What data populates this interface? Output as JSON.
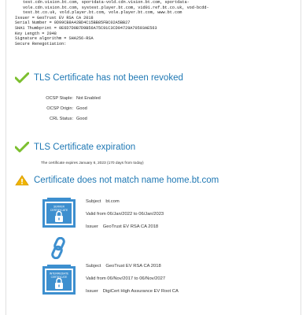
{
  "raw_cert": {
    "lines": [
      "test.cdn.vision.bt.com, sportdata-vold.cdn.vision.bt.com, sportdata-",
      "vole.cdn.vision.bt.com, systest.player.bt.com, vid01.ref.bt.co.uk, vod-bcdd-",
      "test.bt.co.uk, vold.player.bt.com, vole.player.bt.com, www.bt.com",
      "Issuer = GeoTrust EV RSA CA 2018",
      "Serial Number = 0D99CB8A42BD4C15BB85FBC02A5BB27",
      "SHA1 Thumbprint = 0E6D7D0B7D9B56A75C91C3CD94729A70593AE563",
      "Key Length = 2048",
      "Signature algorithm = SHA256-RSA",
      "Secure Renegotiation:"
    ]
  },
  "checks": {
    "revoked": {
      "title": "TLS Certificate has not been revoked",
      "rows": [
        {
          "key": "OCSP Staple:",
          "value": "Not Enabled"
        },
        {
          "key": "OCSP Origin:",
          "value": "Good"
        },
        {
          "key": "CRL Status:",
          "value": "Good"
        }
      ]
    },
    "expiration": {
      "title": "TLS Certificate expiration",
      "note": "The certificate expires January 6, 2023 (170 days from today)"
    },
    "name_mismatch": {
      "title": "Certificate does not match name home.bt.com"
    }
  },
  "chain": {
    "server": {
      "badge_line1": "SERVER",
      "badge_line2": "CERTIFICATE",
      "subject_label": "Subject",
      "subject": "bt.com",
      "valid": "Valid from 06/Jan/2022 to 06/Jan/2023",
      "issuer_label": "Issuer",
      "issuer": "GeoTrust EV RSA CA 2018"
    },
    "intermediate": {
      "badge_line1": "INTERMEDIATE",
      "badge_line2": "CERTIFICATE",
      "subject_label": "Subject",
      "subject": "GeoTrust EV RSA CA 2018",
      "valid": "Valid from 06/Nov/2017 to 06/Nov/2027",
      "issuer_label": "Issuer",
      "issuer": "DigiCert High Assurance EV Root CA"
    }
  },
  "colors": {
    "accent": "#1f78b4",
    "check": "#7cbf2f",
    "warn": "#f0b400",
    "badge": "#3d8fcf"
  }
}
